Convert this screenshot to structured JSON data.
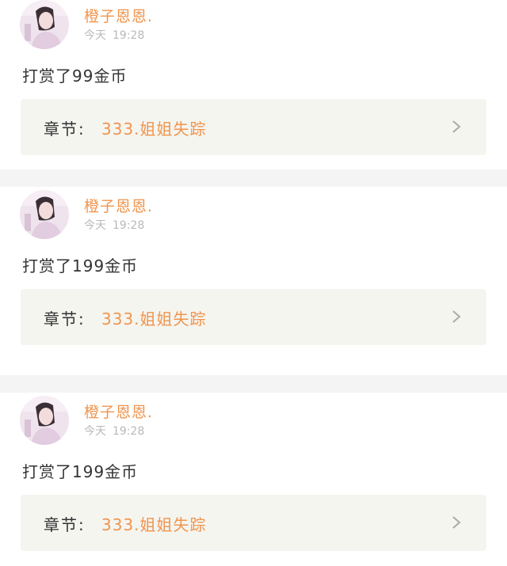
{
  "posts": [
    {
      "username": "橙子恩恩.",
      "day": "今天",
      "time": "19:28",
      "reward_text": "打赏了99金币",
      "chapter_label": "章节:",
      "chapter_title": "333.姐姐失踪"
    },
    {
      "username": "橙子恩恩.",
      "day": "今天",
      "time": "19:28",
      "reward_text": "打赏了199金币",
      "chapter_label": "章节:",
      "chapter_title": "333.姐姐失踪"
    },
    {
      "username": "橙子恩恩.",
      "day": "今天",
      "time": "19:28",
      "reward_text": "打赏了199金币",
      "chapter_label": "章节:",
      "chapter_title": "333.姐姐失踪"
    }
  ],
  "colors": {
    "accent": "#f0944d",
    "text": "#333333",
    "muted": "#b9b9b9",
    "chapter_bg": "#f5f5f0",
    "separator": "#f4f4f4"
  },
  "icons": {
    "chapter_arrow": "chevron-right-icon"
  }
}
